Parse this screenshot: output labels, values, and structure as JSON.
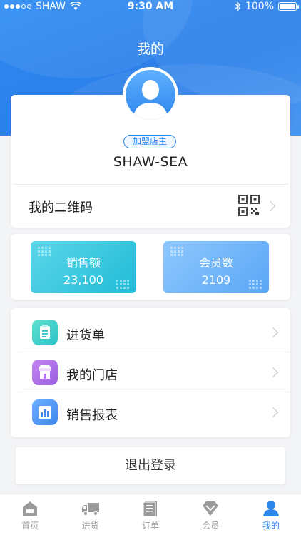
{
  "status_bar": {
    "carrier": "SHAW",
    "time": "9:30 AM",
    "battery": "100%"
  },
  "header": {
    "title": "我的"
  },
  "profile": {
    "role_badge": "加盟店主",
    "username": "SHAW-SEA"
  },
  "qr": {
    "label": "我的二维码"
  },
  "stats": [
    {
      "title": "销售额",
      "value": "23,100"
    },
    {
      "title": "会员数",
      "value": "2109"
    }
  ],
  "menu": [
    {
      "label": "进货单",
      "icon": "clipboard-icon"
    },
    {
      "label": "我的门店",
      "icon": "store-icon"
    },
    {
      "label": "销售报表",
      "icon": "bar-chart-icon"
    }
  ],
  "logout": {
    "label": "退出登录"
  },
  "tabbar": [
    {
      "label": "首页",
      "icon": "home-icon"
    },
    {
      "label": "进货",
      "icon": "truck-icon"
    },
    {
      "label": "订单",
      "icon": "order-icon"
    },
    {
      "label": "会员",
      "icon": "diamond-icon"
    },
    {
      "label": "我的",
      "icon": "user-icon",
      "active": true
    }
  ],
  "colors": {
    "primary": "#2d86ec",
    "sales_card": "#21bcd6",
    "members_card": "#5aa6f5"
  }
}
